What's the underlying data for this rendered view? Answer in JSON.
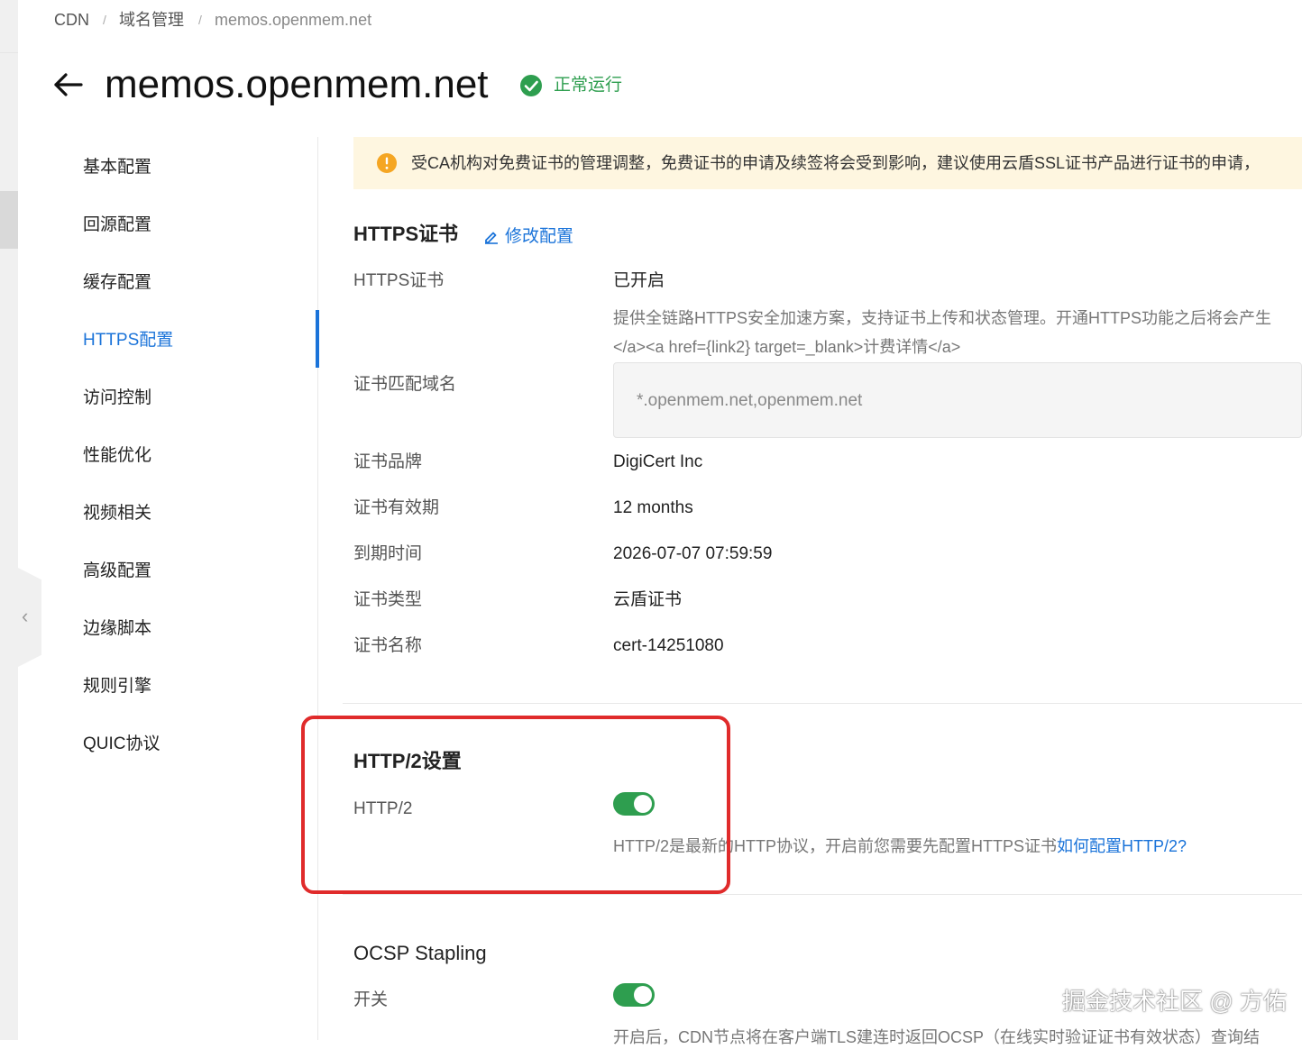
{
  "breadcrumb": {
    "items": [
      "CDN",
      "域名管理",
      "memos.openmem.net"
    ],
    "separator": "/"
  },
  "header": {
    "title": "memos.openmem.net",
    "status": "正常运行",
    "status_color": "#2e9e4f"
  },
  "sidebar": {
    "items": [
      {
        "label": "基本配置"
      },
      {
        "label": "回源配置"
      },
      {
        "label": "缓存配置"
      },
      {
        "label": "HTTPS配置",
        "active": true
      },
      {
        "label": "访问控制"
      },
      {
        "label": "性能优化"
      },
      {
        "label": "视频相关"
      },
      {
        "label": "高级配置"
      },
      {
        "label": "边缘脚本"
      },
      {
        "label": "规则引擎"
      },
      {
        "label": "QUIC协议"
      }
    ],
    "accent_color": "#1a73d9"
  },
  "banner": {
    "text": "受CA机构对免费证书的管理调整，免费证书的申请及续签将会受到影响，建议使用云盾SSL证书产品进行证书的申请，"
  },
  "https_cert": {
    "title": "HTTPS证书",
    "edit_label": "修改配置",
    "rows": {
      "https_cert": {
        "label": "HTTPS证书",
        "value": "已开启"
      },
      "desc_line1": "提供全链路HTTPS安全加速方案，支持证书上传和状态管理。开通HTTPS功能之后将会产生",
      "desc_line2": "</a><a href={link2} target=_blank>计费详情</a>",
      "match_domain": {
        "label": "证书匹配域名",
        "value": "*.openmem.net,openmem.net"
      },
      "brand": {
        "label": "证书品牌",
        "value": "DigiCert Inc"
      },
      "validity": {
        "label": "证书有效期",
        "value": "12 months"
      },
      "expires": {
        "label": "到期时间",
        "value": "2026-07-07 07:59:59"
      },
      "type": {
        "label": "证书类型",
        "value": "云盾证书"
      },
      "name": {
        "label": "证书名称",
        "value": "cert-14251080"
      }
    }
  },
  "http2": {
    "title": "HTTP/2设置",
    "label": "HTTP/2",
    "enabled": true,
    "desc": "HTTP/2是最新的HTTP协议，开启前您需要先配置HTTPS证书",
    "link": "如何配置HTTP/2?"
  },
  "ocsp": {
    "title": "OCSP Stapling",
    "label": "开关",
    "enabled": true,
    "desc": "开启后，CDN节点将在客户端TLS建连时返回OCSP（在线实时验证证书有效状态）查询结"
  },
  "watermark": "掘金技术社区 @ 方佑"
}
